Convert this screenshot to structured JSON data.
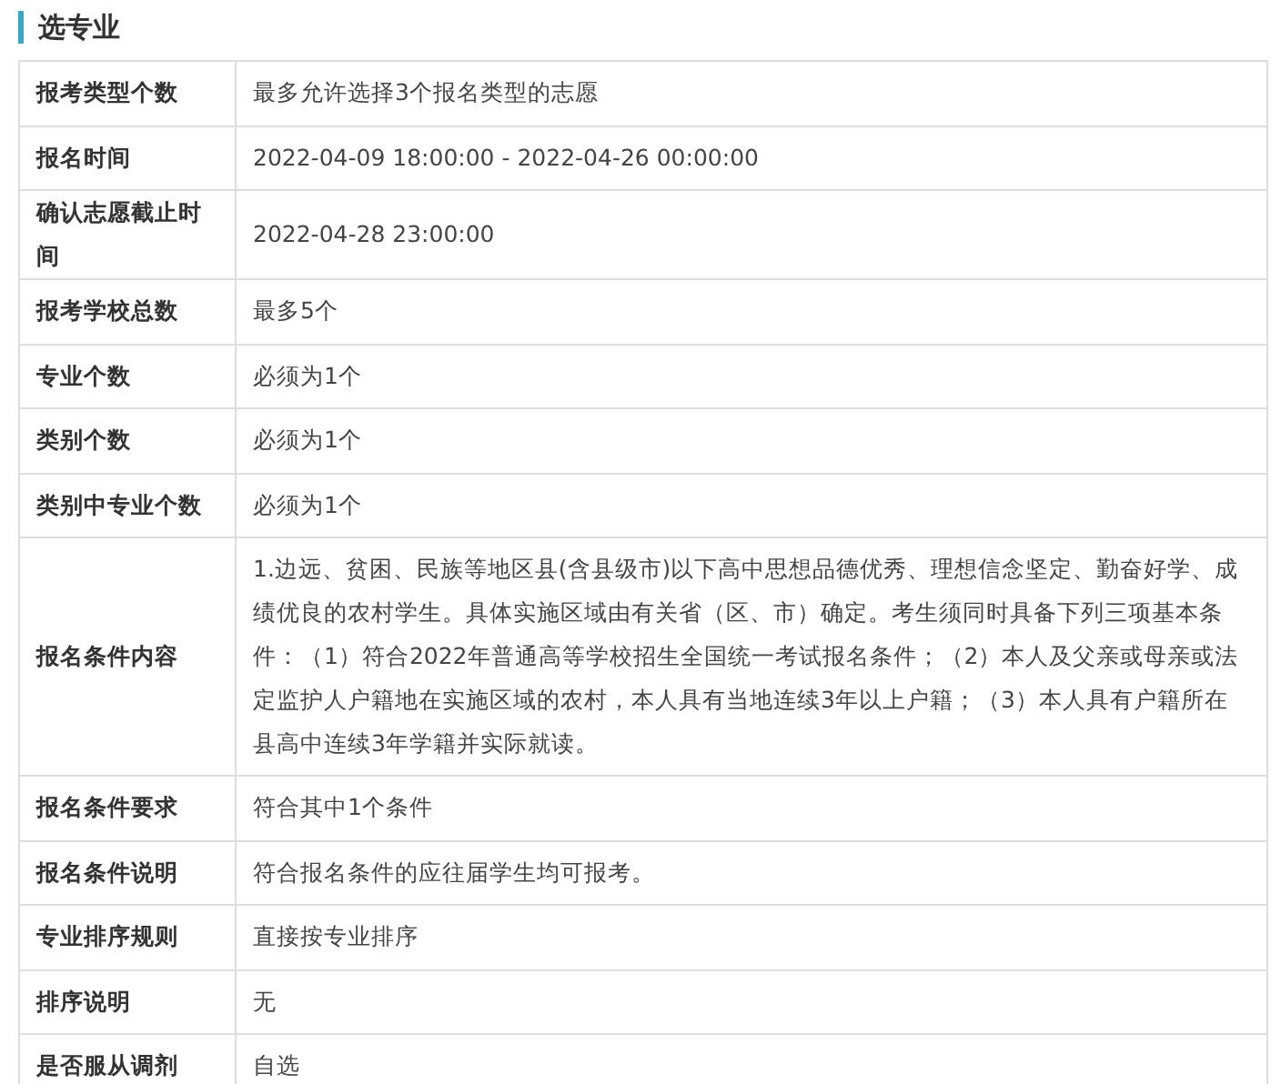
{
  "section_title": "选专业",
  "rows": [
    {
      "label": "报考类型个数",
      "value": "最多允许选择3个报名类型的志愿"
    },
    {
      "label": "报名时间",
      "value": "2022-04-09 18:00:00 - 2022-04-26 00:00:00"
    },
    {
      "label": "确认志愿截止时间",
      "value": "2022-04-28 23:00:00"
    },
    {
      "label": "报考学校总数",
      "value": "最多5个"
    },
    {
      "label": "专业个数",
      "value": "必须为1个"
    },
    {
      "label": "类别个数",
      "value": "必须为1个"
    },
    {
      "label": "类别中专业个数",
      "value": "必须为1个"
    },
    {
      "label": "报名条件内容",
      "value": "1.边远、贫困、民族等地区县(含县级市)以下高中思想品德优秀、理想信念坚定、勤奋好学、成绩优良的农村学生。具体实施区域由有关省（区、市）确定。考生须同时具备下列三项基本条件：（1）符合2022年普通高等学校招生全国统一考试报名条件；（2）本人及父亲或母亲或法定监护人户籍地在实施区域的农村，本人具有当地连续3年以上户籍；（3）本人具有户籍所在县高中连续3年学籍并实际就读。"
    },
    {
      "label": "报名条件要求",
      "value": "符合其中1个条件"
    },
    {
      "label": "报名条件说明",
      "value": "符合报名条件的应往届学生均可报考。"
    },
    {
      "label": "专业排序规则",
      "value": "直接按专业排序"
    },
    {
      "label": "排序说明",
      "value": "无"
    },
    {
      "label": "是否服从调剂",
      "value": "自选"
    }
  ]
}
